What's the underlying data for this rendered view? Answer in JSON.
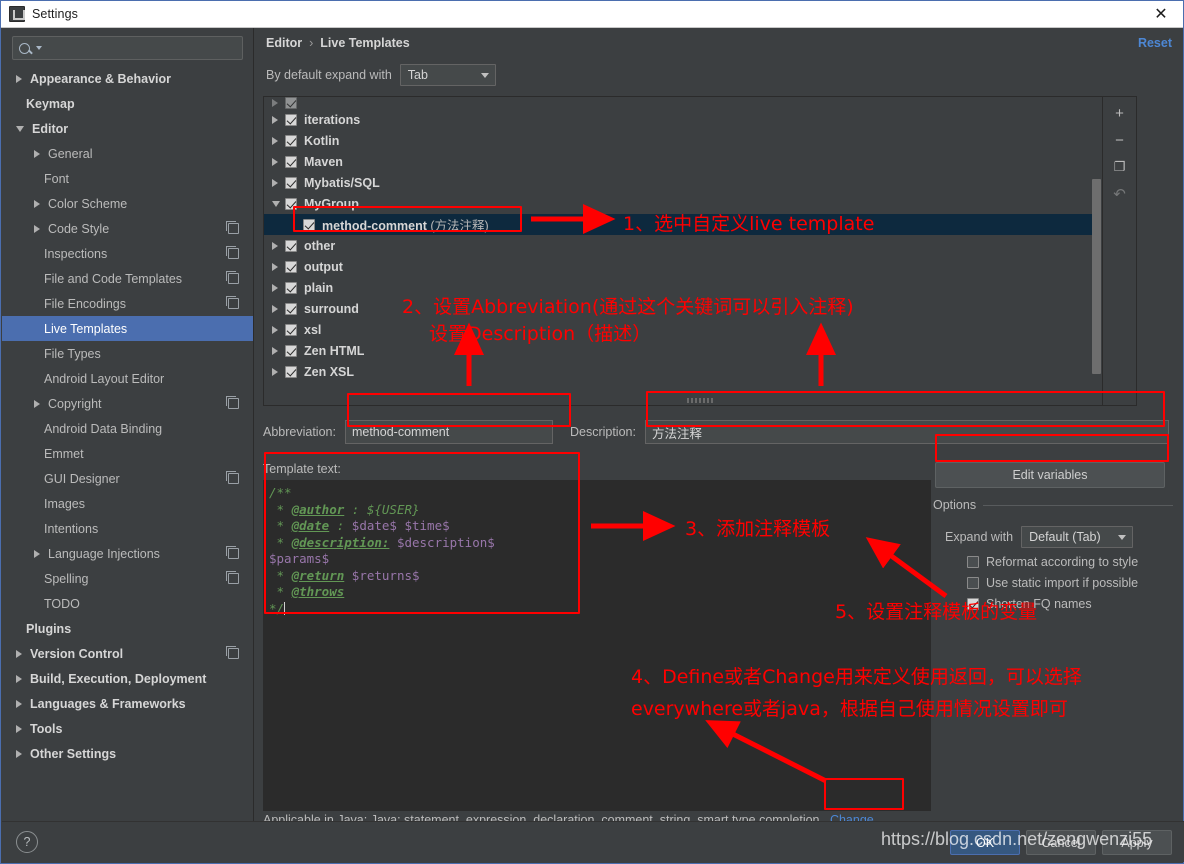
{
  "window": {
    "title": "Settings",
    "close_label": "✕",
    "app_icon": "ide-icon"
  },
  "sidebar": {
    "search": {
      "value": "",
      "placeholder": ""
    },
    "items": [
      {
        "label": "Appearance & Behavior",
        "arrow": "right",
        "indent": 0,
        "bold": true,
        "copy": false,
        "selected": false
      },
      {
        "label": "Keymap",
        "arrow": "none",
        "indent": 0,
        "bold": true,
        "copy": false,
        "selected": false
      },
      {
        "label": "Editor",
        "arrow": "down",
        "indent": 0,
        "bold": true,
        "copy": false,
        "selected": false
      },
      {
        "label": "General",
        "arrow": "right",
        "indent": 1,
        "bold": false,
        "copy": false,
        "selected": false
      },
      {
        "label": "Font",
        "arrow": "none",
        "indent": 1,
        "bold": false,
        "copy": false,
        "selected": false
      },
      {
        "label": "Color Scheme",
        "arrow": "right",
        "indent": 1,
        "bold": false,
        "copy": false,
        "selected": false
      },
      {
        "label": "Code Style",
        "arrow": "right",
        "indent": 1,
        "bold": false,
        "copy": true,
        "selected": false
      },
      {
        "label": "Inspections",
        "arrow": "none",
        "indent": 1,
        "bold": false,
        "copy": true,
        "selected": false
      },
      {
        "label": "File and Code Templates",
        "arrow": "none",
        "indent": 1,
        "bold": false,
        "copy": true,
        "selected": false
      },
      {
        "label": "File Encodings",
        "arrow": "none",
        "indent": 1,
        "bold": false,
        "copy": true,
        "selected": false
      },
      {
        "label": "Live Templates",
        "arrow": "none",
        "indent": 1,
        "bold": false,
        "copy": false,
        "selected": true
      },
      {
        "label": "File Types",
        "arrow": "none",
        "indent": 1,
        "bold": false,
        "copy": false,
        "selected": false
      },
      {
        "label": "Android Layout Editor",
        "arrow": "none",
        "indent": 1,
        "bold": false,
        "copy": false,
        "selected": false
      },
      {
        "label": "Copyright",
        "arrow": "right",
        "indent": 1,
        "bold": false,
        "copy": true,
        "selected": false
      },
      {
        "label": "Android Data Binding",
        "arrow": "none",
        "indent": 1,
        "bold": false,
        "copy": false,
        "selected": false
      },
      {
        "label": "Emmet",
        "arrow": "none",
        "indent": 1,
        "bold": false,
        "copy": false,
        "selected": false
      },
      {
        "label": "GUI Designer",
        "arrow": "none",
        "indent": 1,
        "bold": false,
        "copy": true,
        "selected": false
      },
      {
        "label": "Images",
        "arrow": "none",
        "indent": 1,
        "bold": false,
        "copy": false,
        "selected": false
      },
      {
        "label": "Intentions",
        "arrow": "none",
        "indent": 1,
        "bold": false,
        "copy": false,
        "selected": false
      },
      {
        "label": "Language Injections",
        "arrow": "right",
        "indent": 1,
        "bold": false,
        "copy": true,
        "selected": false
      },
      {
        "label": "Spelling",
        "arrow": "none",
        "indent": 1,
        "bold": false,
        "copy": true,
        "selected": false
      },
      {
        "label": "TODO",
        "arrow": "none",
        "indent": 1,
        "bold": false,
        "copy": false,
        "selected": false
      },
      {
        "label": "Plugins",
        "arrow": "none",
        "indent": 0,
        "bold": true,
        "copy": false,
        "selected": false
      },
      {
        "label": "Version Control",
        "arrow": "right",
        "indent": 0,
        "bold": true,
        "copy": true,
        "selected": false
      },
      {
        "label": "Build, Execution, Deployment",
        "arrow": "right",
        "indent": 0,
        "bold": true,
        "copy": false,
        "selected": false
      },
      {
        "label": "Languages & Frameworks",
        "arrow": "right",
        "indent": 0,
        "bold": true,
        "copy": false,
        "selected": false
      },
      {
        "label": "Tools",
        "arrow": "right",
        "indent": 0,
        "bold": true,
        "copy": false,
        "selected": false
      },
      {
        "label": "Other Settings",
        "arrow": "right",
        "indent": 0,
        "bold": true,
        "copy": false,
        "selected": false
      }
    ]
  },
  "header": {
    "breadcrumb_root": "Editor",
    "breadcrumb_sep": "›",
    "breadcrumb_leaf": "Live Templates",
    "reset_label": "Reset"
  },
  "expand_with": {
    "label": "By default expand with",
    "value": "Tab"
  },
  "templates_list": {
    "rows": [
      {
        "label": "",
        "sub": "",
        "arrow": "right",
        "checked": true,
        "child": false,
        "selected": false,
        "partial": true
      },
      {
        "label": "iterations",
        "sub": "",
        "arrow": "right",
        "checked": true,
        "child": false,
        "selected": false
      },
      {
        "label": "Kotlin",
        "sub": "",
        "arrow": "right",
        "checked": true,
        "child": false,
        "selected": false
      },
      {
        "label": "Maven",
        "sub": "",
        "arrow": "right",
        "checked": true,
        "child": false,
        "selected": false
      },
      {
        "label": "Mybatis/SQL",
        "sub": "",
        "arrow": "right",
        "checked": true,
        "child": false,
        "selected": false
      },
      {
        "label": "MyGroup",
        "sub": "",
        "arrow": "down",
        "checked": true,
        "child": false,
        "selected": false
      },
      {
        "label": "method-comment",
        "sub": " (方法注释)",
        "arrow": "blank",
        "checked": true,
        "child": true,
        "selected": true
      },
      {
        "label": "other",
        "sub": "",
        "arrow": "right",
        "checked": true,
        "child": false,
        "selected": false
      },
      {
        "label": "output",
        "sub": "",
        "arrow": "right",
        "checked": true,
        "child": false,
        "selected": false
      },
      {
        "label": "plain",
        "sub": "",
        "arrow": "right",
        "checked": true,
        "child": false,
        "selected": false
      },
      {
        "label": "surround",
        "sub": "",
        "arrow": "right",
        "checked": true,
        "child": false,
        "selected": false
      },
      {
        "label": "xsl",
        "sub": "",
        "arrow": "right",
        "checked": true,
        "child": false,
        "selected": false
      },
      {
        "label": "Zen HTML",
        "sub": "",
        "arrow": "right",
        "checked": true,
        "child": false,
        "selected": false
      },
      {
        "label": "Zen XSL",
        "sub": "",
        "arrow": "right",
        "checked": true,
        "child": false,
        "selected": false
      }
    ],
    "toolbar": [
      {
        "name": "add-template-button",
        "glyph": "+"
      },
      {
        "name": "remove-template-button",
        "glyph": "−"
      },
      {
        "name": "duplicate-template-button",
        "glyph": "❐"
      },
      {
        "name": "restore-defaults-button",
        "glyph": "↶"
      }
    ]
  },
  "form": {
    "abbreviation_label": "Abbreviation:",
    "abbreviation_value": "method-comment",
    "description_label": "Description:",
    "description_value": "方法注释",
    "template_text_label": "Template text:",
    "template_text_lines": [
      "/**",
      " * @author : ${USER}",
      " * @date : $date$ $time$",
      " * @description: $description$",
      "$params$",
      " * @return $returns$",
      " * @throws",
      "*/"
    ]
  },
  "options": {
    "edit_variables_label": "Edit variables",
    "group_label": "Options",
    "expand_with_label": "Expand with",
    "expand_with_value": "Default (Tab)",
    "checkboxes": [
      {
        "label": "Reformat according to style",
        "checked": false,
        "mnemonic": "R"
      },
      {
        "label": "Use static import if possible",
        "checked": false,
        "mnemonic": "i"
      },
      {
        "label": "Shorten FQ names",
        "checked": true,
        "mnemonic": "FQ"
      }
    ]
  },
  "applicable": {
    "text": "Applicable in Java; Java: statement, expression, declaration, comment, string, smart type completion...",
    "change_label": "Change"
  },
  "footer": {
    "help_label": "?",
    "ok_label": "OK",
    "cancel_label": "Cancel",
    "apply_label": "Apply"
  },
  "watermark": "https://blog.csdn.net/zengwenzi55",
  "annotations": {
    "color": "#ff0000",
    "note1": "1、选中自定义live template",
    "note2_line1": "2、设置Abbreviation(通过这个关键词可以引入注释)",
    "note2_line2": "设置Description（描述）",
    "note3": "3、添加注释模板",
    "note4_line1": "4、Define或者Change用来定义使用返回，可以选择",
    "note4_line2": "everywhere或者java，根据自己使用情况设置即可",
    "note5": "5、设置注释模板的变量"
  }
}
